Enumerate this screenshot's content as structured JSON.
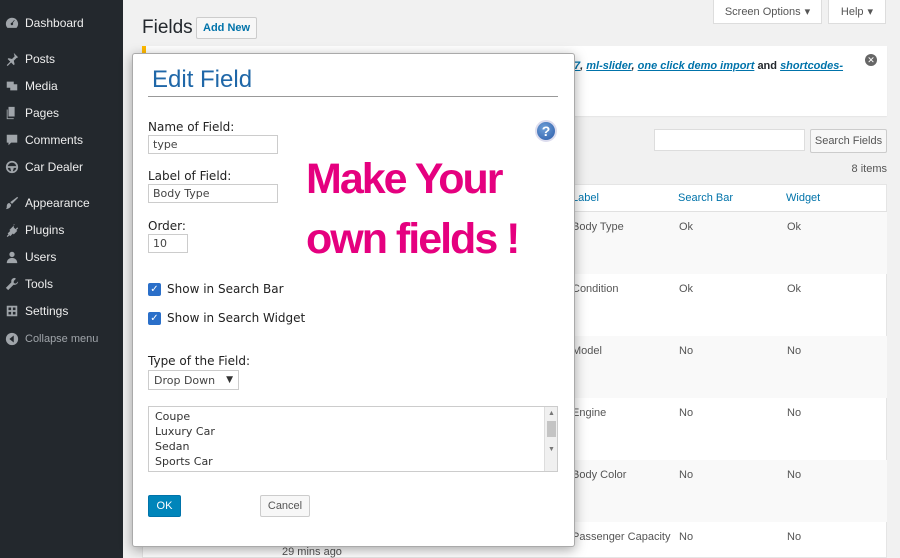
{
  "sidebar": {
    "items": [
      {
        "label": "Dashboard",
        "icon": "dashboard-icon"
      },
      {
        "label": "Posts",
        "icon": "pin-icon"
      },
      {
        "label": "Media",
        "icon": "media-icon"
      },
      {
        "label": "Pages",
        "icon": "pages-icon"
      },
      {
        "label": "Comments",
        "icon": "comments-icon"
      },
      {
        "label": "Car Dealer",
        "icon": "steering-wheel-icon"
      },
      {
        "label": "Appearance",
        "icon": "brush-icon"
      },
      {
        "label": "Plugins",
        "icon": "plug-icon"
      },
      {
        "label": "Users",
        "icon": "users-icon"
      },
      {
        "label": "Tools",
        "icon": "wrench-icon"
      },
      {
        "label": "Settings",
        "icon": "settings-icon"
      }
    ],
    "collapse_label": "Collapse menu"
  },
  "header": {
    "title": "Fields",
    "add_new": "Add New",
    "screen_options": "Screen Options",
    "help": "Help"
  },
  "notice": {
    "link1": "7",
    "link2": "ml-slider",
    "link3": "one click demo import",
    "and_text": "and",
    "link4": "shortcodes-",
    "separator": ","
  },
  "search": {
    "button": "Search Fields",
    "items_count": "8 items"
  },
  "table": {
    "headers": [
      "Label",
      "Search Bar",
      "Widget"
    ],
    "rows": [
      {
        "label": "Body Type",
        "search_bar": "Ok",
        "widget": "Ok"
      },
      {
        "label": "Condition",
        "search_bar": "Ok",
        "widget": "Ok"
      },
      {
        "label": "Model",
        "search_bar": "No",
        "widget": "No"
      },
      {
        "label": "Engine",
        "search_bar": "No",
        "widget": "No"
      },
      {
        "label": "Body Color",
        "search_bar": "No",
        "widget": "No"
      },
      {
        "label": "Passenger Capacity",
        "search_bar": "No",
        "widget": "No"
      }
    ],
    "time_ago": "29 mins ago"
  },
  "modal": {
    "title": "Edit Field",
    "name_label": "Name of Field:",
    "name_value": "type",
    "label_label": "Label of Field:",
    "label_value": "Body Type",
    "order_label": "Order:",
    "order_value": "10",
    "help_glyph": "?",
    "show_search_bar": "Show in Search Bar",
    "show_search_widget": "Show in Search Widget",
    "type_label": "Type of the Field:",
    "type_value": "Drop Down",
    "options": [
      "Coupe",
      "Luxury Car",
      "Sedan",
      "Sports Car"
    ],
    "ok": "OK",
    "cancel": "Cancel"
  },
  "promo": {
    "line1": "Make Your",
    "line2": "own fields !",
    "color": "#e5007f"
  },
  "colors": {
    "sidebar_bg": "#23282d",
    "accent": "#0073aa",
    "modal_title": "#1f67a8"
  }
}
